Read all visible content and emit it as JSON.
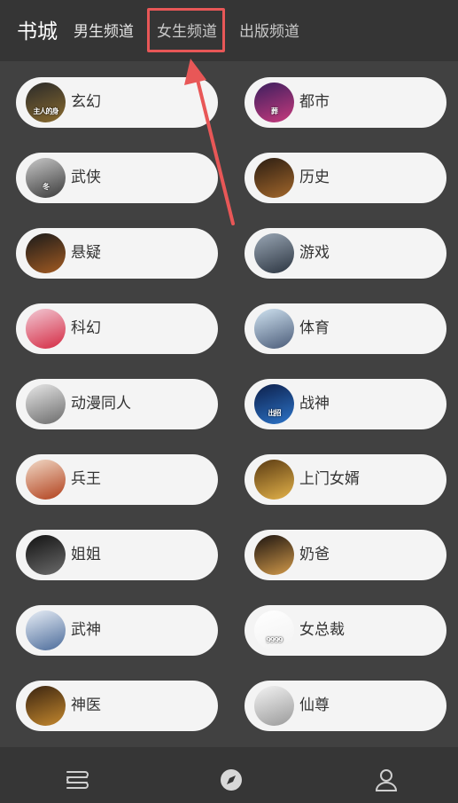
{
  "header": {
    "title": "书城",
    "tabs": [
      {
        "label": "男生频道"
      },
      {
        "label": "女生频道"
      },
      {
        "label": "出版频道"
      }
    ]
  },
  "categories": [
    {
      "label": "玄幻",
      "cover_text": "主人的身",
      "cover_colors": [
        "#2a2a2a",
        "#8a6b2e"
      ]
    },
    {
      "label": "都市",
      "cover_text": "葬",
      "cover_colors": [
        "#3b1f5e",
        "#c83a7d"
      ]
    },
    {
      "label": "武侠",
      "cover_text": "冬",
      "cover_colors": [
        "#c8c8c8",
        "#3a3a3a"
      ]
    },
    {
      "label": "历史",
      "cover_text": "",
      "cover_colors": [
        "#2b1d12",
        "#a3672b"
      ]
    },
    {
      "label": "悬疑",
      "cover_text": "",
      "cover_colors": [
        "#1a1a1a",
        "#a35b22"
      ]
    },
    {
      "label": "游戏",
      "cover_text": "",
      "cover_colors": [
        "#9aa7b5",
        "#2b3440"
      ]
    },
    {
      "label": "科幻",
      "cover_text": "",
      "cover_colors": [
        "#f2c9d4",
        "#d42a43"
      ]
    },
    {
      "label": "体育",
      "cover_text": "",
      "cover_colors": [
        "#cfe2f0",
        "#4a5b78"
      ]
    },
    {
      "label": "动漫同人",
      "cover_text": "",
      "cover_colors": [
        "#e7e7e7",
        "#6b6b6b"
      ]
    },
    {
      "label": "战神",
      "cover_text": "出招",
      "cover_colors": [
        "#0d1f4a",
        "#2c74c9"
      ]
    },
    {
      "label": "兵王",
      "cover_text": "",
      "cover_colors": [
        "#f1d9c6",
        "#b1401c"
      ]
    },
    {
      "label": "上门女婿",
      "cover_text": "",
      "cover_colors": [
        "#5a3a12",
        "#e4b34a"
      ]
    },
    {
      "label": "姐姐",
      "cover_text": "",
      "cover_colors": [
        "#121212",
        "#6b6b6b"
      ]
    },
    {
      "label": "奶爸",
      "cover_text": "",
      "cover_colors": [
        "#1c1410",
        "#d29a4a"
      ]
    },
    {
      "label": "武神",
      "cover_text": "",
      "cover_colors": [
        "#e8eef6",
        "#4b6b9a"
      ]
    },
    {
      "label": "女总裁",
      "cover_text": "9999",
      "cover_colors": [
        "#ffffff",
        "#f2f2f2"
      ]
    },
    {
      "label": "神医",
      "cover_text": "",
      "cover_colors": [
        "#3a2410",
        "#c4882e"
      ]
    },
    {
      "label": "仙尊",
      "cover_text": "",
      "cover_colors": [
        "#f3f3f3",
        "#9a9a9a"
      ]
    }
  ],
  "bottom_nav": [
    {
      "icon": "bookshelf-icon"
    },
    {
      "icon": "compass-icon"
    },
    {
      "icon": "profile-icon"
    }
  ],
  "annotation": {
    "color": "#e85757"
  }
}
